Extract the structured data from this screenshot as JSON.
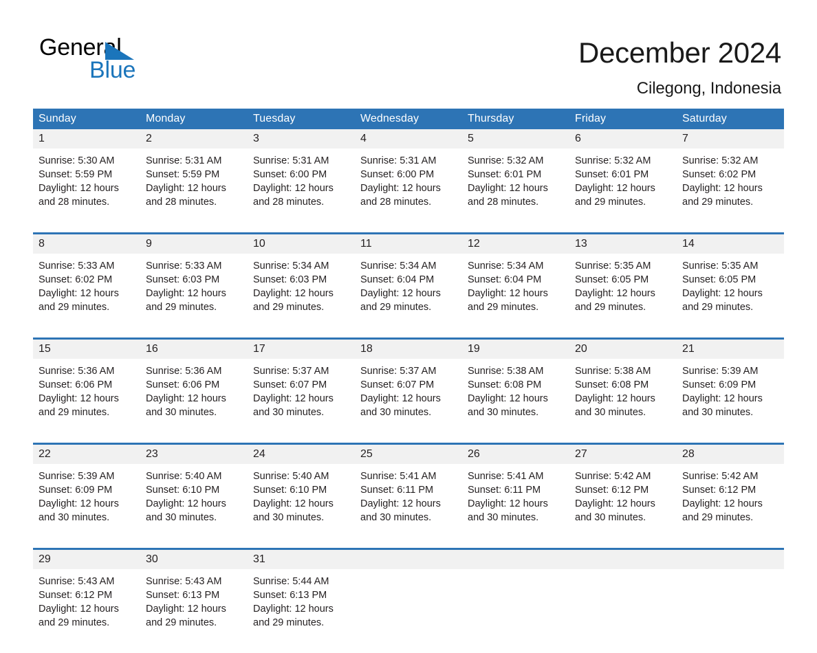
{
  "brand": {
    "name_part1": "General",
    "name_part2": "Blue",
    "logo_icon": "triangle-flag-icon",
    "accent_color": "#1b75bb"
  },
  "header": {
    "month_title": "December 2024",
    "location": "Cilegong, Indonesia"
  },
  "colors": {
    "header_blue": "#2d74b5",
    "daynum_background": "#f1f1f1",
    "text": "#231f20"
  },
  "weekday_headers": [
    "Sunday",
    "Monday",
    "Tuesday",
    "Wednesday",
    "Thursday",
    "Friday",
    "Saturday"
  ],
  "weeks": [
    {
      "days": [
        {
          "date": "1",
          "sunrise": "Sunrise: 5:30 AM",
          "sunset": "Sunset: 5:59 PM",
          "daylight_line1": "Daylight: 12 hours",
          "daylight_line2": "and 28 minutes."
        },
        {
          "date": "2",
          "sunrise": "Sunrise: 5:31 AM",
          "sunset": "Sunset: 5:59 PM",
          "daylight_line1": "Daylight: 12 hours",
          "daylight_line2": "and 28 minutes."
        },
        {
          "date": "3",
          "sunrise": "Sunrise: 5:31 AM",
          "sunset": "Sunset: 6:00 PM",
          "daylight_line1": "Daylight: 12 hours",
          "daylight_line2": "and 28 minutes."
        },
        {
          "date": "4",
          "sunrise": "Sunrise: 5:31 AM",
          "sunset": "Sunset: 6:00 PM",
          "daylight_line1": "Daylight: 12 hours",
          "daylight_line2": "and 28 minutes."
        },
        {
          "date": "5",
          "sunrise": "Sunrise: 5:32 AM",
          "sunset": "Sunset: 6:01 PM",
          "daylight_line1": "Daylight: 12 hours",
          "daylight_line2": "and 28 minutes."
        },
        {
          "date": "6",
          "sunrise": "Sunrise: 5:32 AM",
          "sunset": "Sunset: 6:01 PM",
          "daylight_line1": "Daylight: 12 hours",
          "daylight_line2": "and 29 minutes."
        },
        {
          "date": "7",
          "sunrise": "Sunrise: 5:32 AM",
          "sunset": "Sunset: 6:02 PM",
          "daylight_line1": "Daylight: 12 hours",
          "daylight_line2": "and 29 minutes."
        }
      ]
    },
    {
      "days": [
        {
          "date": "8",
          "sunrise": "Sunrise: 5:33 AM",
          "sunset": "Sunset: 6:02 PM",
          "daylight_line1": "Daylight: 12 hours",
          "daylight_line2": "and 29 minutes."
        },
        {
          "date": "9",
          "sunrise": "Sunrise: 5:33 AM",
          "sunset": "Sunset: 6:03 PM",
          "daylight_line1": "Daylight: 12 hours",
          "daylight_line2": "and 29 minutes."
        },
        {
          "date": "10",
          "sunrise": "Sunrise: 5:34 AM",
          "sunset": "Sunset: 6:03 PM",
          "daylight_line1": "Daylight: 12 hours",
          "daylight_line2": "and 29 minutes."
        },
        {
          "date": "11",
          "sunrise": "Sunrise: 5:34 AM",
          "sunset": "Sunset: 6:04 PM",
          "daylight_line1": "Daylight: 12 hours",
          "daylight_line2": "and 29 minutes."
        },
        {
          "date": "12",
          "sunrise": "Sunrise: 5:34 AM",
          "sunset": "Sunset: 6:04 PM",
          "daylight_line1": "Daylight: 12 hours",
          "daylight_line2": "and 29 minutes."
        },
        {
          "date": "13",
          "sunrise": "Sunrise: 5:35 AM",
          "sunset": "Sunset: 6:05 PM",
          "daylight_line1": "Daylight: 12 hours",
          "daylight_line2": "and 29 minutes."
        },
        {
          "date": "14",
          "sunrise": "Sunrise: 5:35 AM",
          "sunset": "Sunset: 6:05 PM",
          "daylight_line1": "Daylight: 12 hours",
          "daylight_line2": "and 29 minutes."
        }
      ]
    },
    {
      "days": [
        {
          "date": "15",
          "sunrise": "Sunrise: 5:36 AM",
          "sunset": "Sunset: 6:06 PM",
          "daylight_line1": "Daylight: 12 hours",
          "daylight_line2": "and 29 minutes."
        },
        {
          "date": "16",
          "sunrise": "Sunrise: 5:36 AM",
          "sunset": "Sunset: 6:06 PM",
          "daylight_line1": "Daylight: 12 hours",
          "daylight_line2": "and 30 minutes."
        },
        {
          "date": "17",
          "sunrise": "Sunrise: 5:37 AM",
          "sunset": "Sunset: 6:07 PM",
          "daylight_line1": "Daylight: 12 hours",
          "daylight_line2": "and 30 minutes."
        },
        {
          "date": "18",
          "sunrise": "Sunrise: 5:37 AM",
          "sunset": "Sunset: 6:07 PM",
          "daylight_line1": "Daylight: 12 hours",
          "daylight_line2": "and 30 minutes."
        },
        {
          "date": "19",
          "sunrise": "Sunrise: 5:38 AM",
          "sunset": "Sunset: 6:08 PM",
          "daylight_line1": "Daylight: 12 hours",
          "daylight_line2": "and 30 minutes."
        },
        {
          "date": "20",
          "sunrise": "Sunrise: 5:38 AM",
          "sunset": "Sunset: 6:08 PM",
          "daylight_line1": "Daylight: 12 hours",
          "daylight_line2": "and 30 minutes."
        },
        {
          "date": "21",
          "sunrise": "Sunrise: 5:39 AM",
          "sunset": "Sunset: 6:09 PM",
          "daylight_line1": "Daylight: 12 hours",
          "daylight_line2": "and 30 minutes."
        }
      ]
    },
    {
      "days": [
        {
          "date": "22",
          "sunrise": "Sunrise: 5:39 AM",
          "sunset": "Sunset: 6:09 PM",
          "daylight_line1": "Daylight: 12 hours",
          "daylight_line2": "and 30 minutes."
        },
        {
          "date": "23",
          "sunrise": "Sunrise: 5:40 AM",
          "sunset": "Sunset: 6:10 PM",
          "daylight_line1": "Daylight: 12 hours",
          "daylight_line2": "and 30 minutes."
        },
        {
          "date": "24",
          "sunrise": "Sunrise: 5:40 AM",
          "sunset": "Sunset: 6:10 PM",
          "daylight_line1": "Daylight: 12 hours",
          "daylight_line2": "and 30 minutes."
        },
        {
          "date": "25",
          "sunrise": "Sunrise: 5:41 AM",
          "sunset": "Sunset: 6:11 PM",
          "daylight_line1": "Daylight: 12 hours",
          "daylight_line2": "and 30 minutes."
        },
        {
          "date": "26",
          "sunrise": "Sunrise: 5:41 AM",
          "sunset": "Sunset: 6:11 PM",
          "daylight_line1": "Daylight: 12 hours",
          "daylight_line2": "and 30 minutes."
        },
        {
          "date": "27",
          "sunrise": "Sunrise: 5:42 AM",
          "sunset": "Sunset: 6:12 PM",
          "daylight_line1": "Daylight: 12 hours",
          "daylight_line2": "and 30 minutes."
        },
        {
          "date": "28",
          "sunrise": "Sunrise: 5:42 AM",
          "sunset": "Sunset: 6:12 PM",
          "daylight_line1": "Daylight: 12 hours",
          "daylight_line2": "and 29 minutes."
        }
      ]
    },
    {
      "days": [
        {
          "date": "29",
          "sunrise": "Sunrise: 5:43 AM",
          "sunset": "Sunset: 6:12 PM",
          "daylight_line1": "Daylight: 12 hours",
          "daylight_line2": "and 29 minutes."
        },
        {
          "date": "30",
          "sunrise": "Sunrise: 5:43 AM",
          "sunset": "Sunset: 6:13 PM",
          "daylight_line1": "Daylight: 12 hours",
          "daylight_line2": "and 29 minutes."
        },
        {
          "date": "31",
          "sunrise": "Sunrise: 5:44 AM",
          "sunset": "Sunset: 6:13 PM",
          "daylight_line1": "Daylight: 12 hours",
          "daylight_line2": "and 29 minutes."
        },
        {
          "date": "",
          "sunrise": "",
          "sunset": "",
          "daylight_line1": "",
          "daylight_line2": ""
        },
        {
          "date": "",
          "sunrise": "",
          "sunset": "",
          "daylight_line1": "",
          "daylight_line2": ""
        },
        {
          "date": "",
          "sunrise": "",
          "sunset": "",
          "daylight_line1": "",
          "daylight_line2": ""
        },
        {
          "date": "",
          "sunrise": "",
          "sunset": "",
          "daylight_line1": "",
          "daylight_line2": ""
        }
      ]
    }
  ]
}
